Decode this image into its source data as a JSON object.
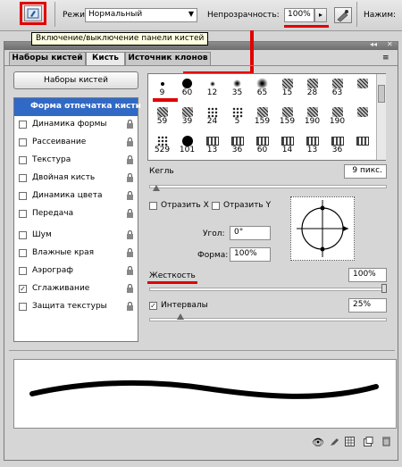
{
  "toolbar": {
    "mode_label": "Режим:",
    "mode_value": "Нормальный",
    "opacity_label": "Непрозрачность:",
    "opacity_value": "100%",
    "press_label": "Нажим:",
    "tooltip": "Включение/выключение панели кистей"
  },
  "tabs": [
    {
      "label": "Наборы кистей"
    },
    {
      "label": "Кисть"
    },
    {
      "label": "Источник клонов"
    }
  ],
  "presets_button": "Наборы кистей",
  "settings": [
    {
      "label": "Форма отпечатка кисти",
      "checkbox": false,
      "checked": false,
      "lock": false,
      "selected": true
    },
    {
      "label": "Динамика формы",
      "checkbox": true,
      "checked": false,
      "lock": true,
      "selected": false
    },
    {
      "label": "Рассеивание",
      "checkbox": true,
      "checked": false,
      "lock": true,
      "selected": false
    },
    {
      "label": "Текстура",
      "checkbox": true,
      "checked": false,
      "lock": true,
      "selected": false
    },
    {
      "label": "Двойная кисть",
      "checkbox": true,
      "checked": false,
      "lock": true,
      "selected": false
    },
    {
      "label": "Динамика цвета",
      "checkbox": true,
      "checked": false,
      "lock": true,
      "selected": false
    },
    {
      "label": "Передача",
      "checkbox": true,
      "checked": false,
      "lock": true,
      "selected": false
    },
    {
      "label": "Шум",
      "checkbox": true,
      "checked": false,
      "lock": true,
      "selected": false
    },
    {
      "label": "Влажные края",
      "checkbox": true,
      "checked": false,
      "lock": true,
      "selected": false
    },
    {
      "label": "Аэрограф",
      "checkbox": true,
      "checked": false,
      "lock": true,
      "selected": false
    },
    {
      "label": "Сглаживание",
      "checkbox": true,
      "checked": true,
      "lock": true,
      "selected": false
    },
    {
      "label": "Защита текстуры",
      "checkbox": true,
      "checked": false,
      "lock": true,
      "selected": false
    }
  ],
  "brushes": [
    {
      "size": "9",
      "shape": "dot"
    },
    {
      "size": "60",
      "shape": "dot"
    },
    {
      "size": "12",
      "shape": "soft"
    },
    {
      "size": "35",
      "shape": "soft"
    },
    {
      "size": "65",
      "shape": "soft"
    },
    {
      "size": "15",
      "shape": "texture"
    },
    {
      "size": "28",
      "shape": "texture"
    },
    {
      "size": "63",
      "shape": "texture"
    },
    {
      "size": "",
      "shape": "texture"
    },
    {
      "size": "59",
      "shape": "texture"
    },
    {
      "size": "39",
      "shape": "texture"
    },
    {
      "size": "24",
      "shape": "scatter"
    },
    {
      "size": "5",
      "shape": "scatter"
    },
    {
      "size": "159",
      "shape": "texture"
    },
    {
      "size": "159",
      "shape": "texture"
    },
    {
      "size": "190",
      "shape": "texture"
    },
    {
      "size": "190",
      "shape": "texture"
    },
    {
      "size": "",
      "shape": "texture"
    },
    {
      "size": "529",
      "shape": "scatter"
    },
    {
      "size": "101",
      "shape": "dot"
    },
    {
      "size": "13",
      "shape": "icon"
    },
    {
      "size": "36",
      "shape": "icon"
    },
    {
      "size": "60",
      "shape": "icon"
    },
    {
      "size": "14",
      "shape": "icon"
    },
    {
      "size": "13",
      "shape": "icon"
    },
    {
      "size": "36",
      "shape": "icon"
    },
    {
      "size": "",
      "shape": "icon"
    }
  ],
  "size_label": "Кегль",
  "size_value": "9 пикс.",
  "size_fraction": 0.03,
  "flip_x_label": "Отразить X",
  "flip_y_label": "Отразить Y",
  "angle_label": "Угол:",
  "angle_value": "0°",
  "roundness_label": "Форма:",
  "roundness_value": "100%",
  "hardness_label": "Жесткость",
  "hardness_value": "100%",
  "hardness_fraction": 1.0,
  "spacing_label": "Интервалы",
  "spacing_value": "25%",
  "spacing_checked": true,
  "spacing_fraction": 0.13,
  "accent_red": "#e10000",
  "selection_blue": "#3169c6"
}
